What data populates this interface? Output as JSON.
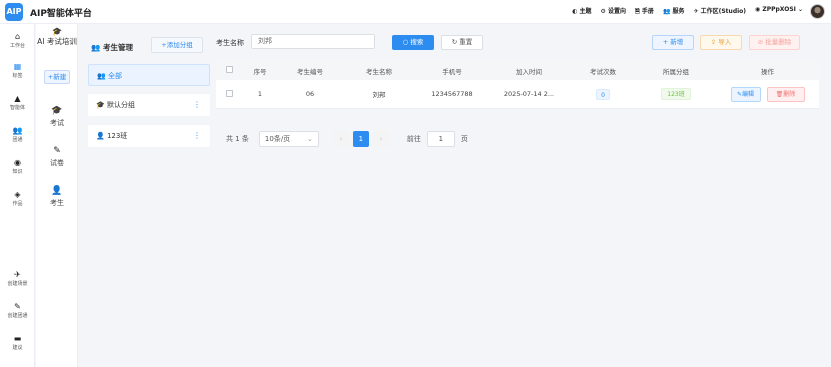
{
  "app": {
    "logo": "AIP",
    "title": "AIP智能体平台"
  },
  "topnav": {
    "theme": "◐ 主题",
    "settings": "⚙ 设置向",
    "manual": "🗎 手册",
    "service": "👥 服务",
    "workbench": "✈ 工作区(Studio)",
    "user": "◉ ZPPpXOSI ⌄"
  },
  "leftnav": [
    {
      "icon": "home-icon",
      "glyph": "⌂",
      "label": "工作台"
    },
    {
      "icon": "grid-icon",
      "glyph": "▦",
      "label": "标签"
    },
    {
      "icon": "agent-icon",
      "glyph": "▲",
      "label": "智能体"
    },
    {
      "icon": "team-icon",
      "glyph": "👥",
      "label": "团通"
    },
    {
      "icon": "knowledge-icon",
      "glyph": "◉",
      "label": "知识"
    },
    {
      "icon": "work-icon",
      "glyph": "◈",
      "label": "作品"
    },
    {
      "icon": "send-icon",
      "glyph": "✈",
      "label": "创建场景"
    },
    {
      "icon": "wrench-icon",
      "glyph": "✎",
      "label": "创建团通"
    },
    {
      "icon": "feedback-icon",
      "glyph": "▬",
      "label": "建议"
    }
  ],
  "subnav": {
    "title_icon": "graduation-cap-icon",
    "title": "AI 考试培训",
    "new_label": "+新建",
    "items": [
      {
        "icon": "exam-icon",
        "glyph": "🎓",
        "label": "考试"
      },
      {
        "icon": "paper-icon",
        "glyph": "✎",
        "label": "试卷"
      },
      {
        "icon": "student-icon",
        "glyph": "👤",
        "label": "考生"
      }
    ]
  },
  "groups": {
    "title": "👥 考生管理",
    "add_label": "+添加分组",
    "items": [
      {
        "label": "👥 全部",
        "active": true
      },
      {
        "label": "🎓 默认分组",
        "active": false
      },
      {
        "label": "👤 123班",
        "active": false
      }
    ]
  },
  "search": {
    "label": "考生名称",
    "value": "刘邦",
    "search_btn": "○ 搜索",
    "reset_btn": "↻ 重置"
  },
  "actions": {
    "add": "+ 新增",
    "import": "⇪ 导入",
    "batch_delete": "⊘ 批量删除"
  },
  "table": {
    "headers": [
      "序号",
      "考生编号",
      "考生名称",
      "手机号",
      "加入时间",
      "考试次数",
      "所属分组",
      "操作"
    ],
    "rows": [
      {
        "index": "1",
        "code": "06",
        "name": "刘邦",
        "phone": "1234567788",
        "join_time": "2025-07-14 2...",
        "exam_count": "0",
        "group": "123班",
        "edit": "✎编辑",
        "delete": "🗑删除"
      }
    ]
  },
  "pager": {
    "total": "共 1 条",
    "page_size": "10条/页",
    "prev": "‹",
    "current": "1",
    "next": "›",
    "goto_label": "前往",
    "goto_value": "1",
    "page_suffix": "页"
  },
  "colors": {
    "primary": "#2d8cf0",
    "success": "#67c23a",
    "danger": "#f56c6c",
    "warning": "#e6a23c"
  }
}
